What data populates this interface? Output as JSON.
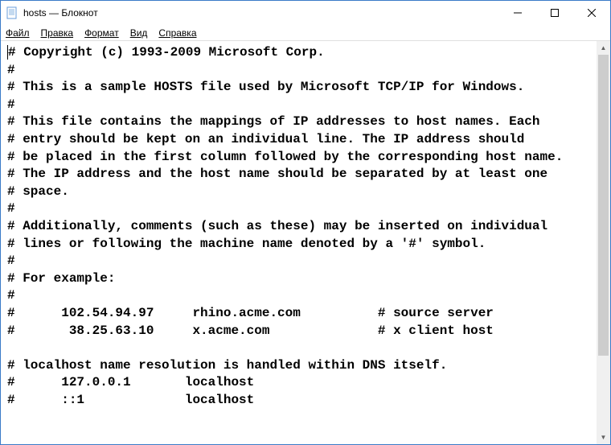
{
  "window": {
    "title": "hosts — Блокнот"
  },
  "menu": {
    "file": "Файл",
    "edit": "Правка",
    "format": "Формат",
    "view": "Вид",
    "help": "Справка"
  },
  "content": {
    "lines": [
      "# Copyright (c) 1993-2009 Microsoft Corp.",
      "#",
      "# This is a sample HOSTS file used by Microsoft TCP/IP for Windows.",
      "#",
      "# This file contains the mappings of IP addresses to host names. Each",
      "# entry should be kept on an individual line. The IP address should",
      "# be placed in the first column followed by the corresponding host name.",
      "# The IP address and the host name should be separated by at least one",
      "# space.",
      "#",
      "# Additionally, comments (such as these) may be inserted on individual",
      "# lines or following the machine name denoted by a '#' symbol.",
      "#",
      "# For example:",
      "#",
      "#      102.54.94.97     rhino.acme.com          # source server",
      "#       38.25.63.10     x.acme.com              # x client host",
      "",
      "# localhost name resolution is handled within DNS itself.",
      "#      127.0.0.1       localhost",
      "#      ::1             localhost"
    ]
  }
}
